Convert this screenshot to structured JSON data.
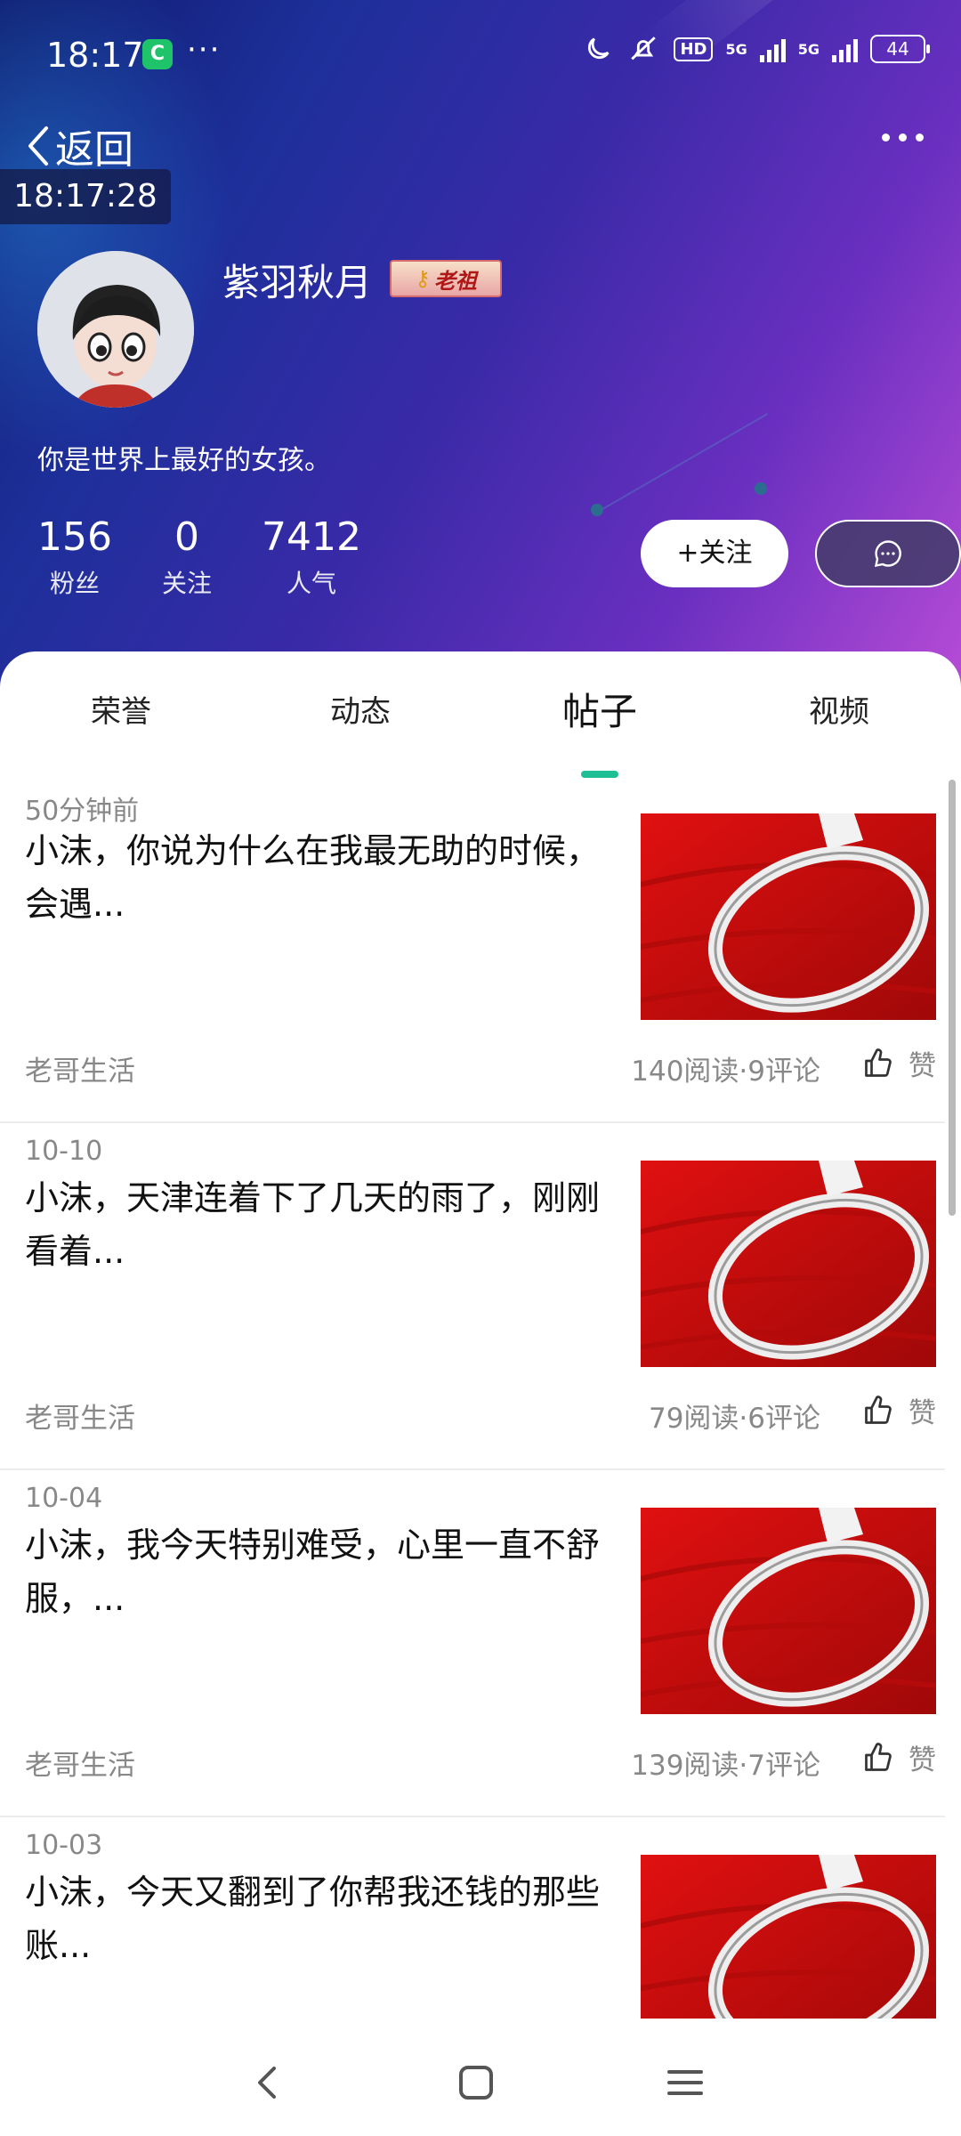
{
  "status_bar": {
    "time": "18:17",
    "app_badge": "C",
    "notif_dots": "···",
    "hd_label": "HD",
    "signal1_label": "5G",
    "signal2_label": "5G",
    "battery": "44"
  },
  "header": {
    "back_label": "返回",
    "timestamp_overlay": "18:17:28"
  },
  "profile": {
    "username": "紫羽秋月",
    "badge_text": "老祖",
    "bio": "你是世界上最好的女孩。",
    "stats": [
      {
        "value": "156",
        "label": "粉丝"
      },
      {
        "value": "0",
        "label": "关注"
      },
      {
        "value": "7412",
        "label": "人气"
      }
    ],
    "follow_label": "+关注"
  },
  "tabs": [
    {
      "label": "荣誉",
      "active": false
    },
    {
      "label": "动态",
      "active": false
    },
    {
      "label": "帖子",
      "active": true
    },
    {
      "label": "视频",
      "active": false
    }
  ],
  "posts": [
    {
      "date": "50分钟前",
      "title": "小沫，你说为什么在我最无助的时候，会遇...",
      "section": "老哥生活",
      "meta": "140阅读·9评论",
      "like": "赞"
    },
    {
      "date": "10-10",
      "title": "小沫，天津连着下了几天的雨了，刚刚看着...",
      "section": "老哥生活",
      "meta": "79阅读·6评论",
      "like": "赞"
    },
    {
      "date": "10-04",
      "title": "小沫，我今天特别难受，心里一直不舒服，...",
      "section": "老哥生活",
      "meta": "139阅读·7评论",
      "like": "赞"
    },
    {
      "date": "10-03",
      "title": "小沫，今天又翻到了你帮我还钱的那些账...",
      "section": "",
      "meta": "",
      "like": ""
    }
  ],
  "colors": {
    "accent": "#1fbf95",
    "header_start": "#101a6e",
    "header_end": "#b74cd7",
    "thumb_red": "#c80d0d"
  }
}
